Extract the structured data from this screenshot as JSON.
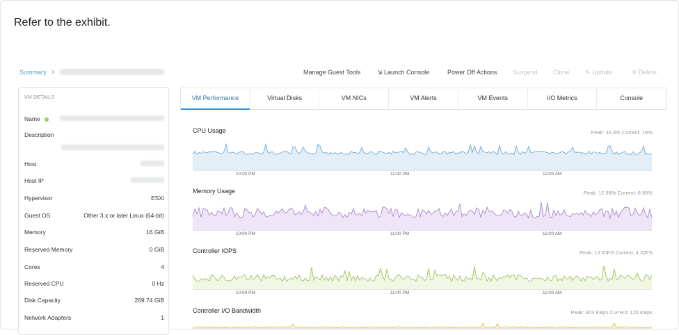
{
  "exhibit_text": "Refer to the exhibit.",
  "breadcrumb": {
    "summary": "Summary",
    "separator": "›"
  },
  "actions": {
    "manage_guest_tools": "Manage Guest Tools",
    "launch_console": "Launch Console",
    "power_off_actions": "Power Off Actions",
    "suspend": "Suspend",
    "clone": "Clone",
    "update": "Update",
    "delete": "Delete"
  },
  "vm_details": {
    "title": "VM DETAILS",
    "rows": [
      {
        "label": "Name",
        "value": ""
      },
      {
        "label": "Description",
        "value": ""
      },
      {
        "label": "Host",
        "value": ""
      },
      {
        "label": "Host IP",
        "value": ""
      },
      {
        "label": "Hypervisor",
        "value": "ESXi"
      },
      {
        "label": "Guest OS",
        "value": "Other 3.x or later Linux (64-bit)"
      },
      {
        "label": "Memory",
        "value": "16 GiB"
      },
      {
        "label": "Reserved Memory",
        "value": "0 GiB"
      },
      {
        "label": "Cores",
        "value": "4"
      },
      {
        "label": "Reserved CPU",
        "value": "0 Hz"
      },
      {
        "label": "Disk Capacity",
        "value": "269.74 GiB"
      },
      {
        "label": "Network Adapters",
        "value": "1"
      }
    ]
  },
  "tabs": [
    "VM Performance",
    "Virtual Disks",
    "VM NICs",
    "VM Alerts",
    "VM Events",
    "I/O Metrics",
    "Console"
  ],
  "time_ticks": [
    "10:00 PM",
    "11:00 PM",
    "12:00 AM"
  ],
  "charts": [
    {
      "title": "CPU Usage",
      "stats": "Peak: 30.3%   Current: 16%",
      "color": "#7fb0d6",
      "fill": "#e3eef7"
    },
    {
      "title": "Memory Usage",
      "stats": "Peak: 12.99%   Current: 6.99%",
      "color": "#b48fd3",
      "fill": "#eee5f6"
    },
    {
      "title": "Controller IOPS",
      "stats": "Peak: 13 IOPS   Current: 4 IOPS",
      "color": "#a8c76a",
      "fill": "#f1f6e5"
    },
    {
      "title": "Controller I/O Bandwidth",
      "stats": "Peak: 303 KBps   Current: 126 KBps",
      "color": "#e8c64a",
      "fill": "#fbf4dc"
    }
  ]
}
